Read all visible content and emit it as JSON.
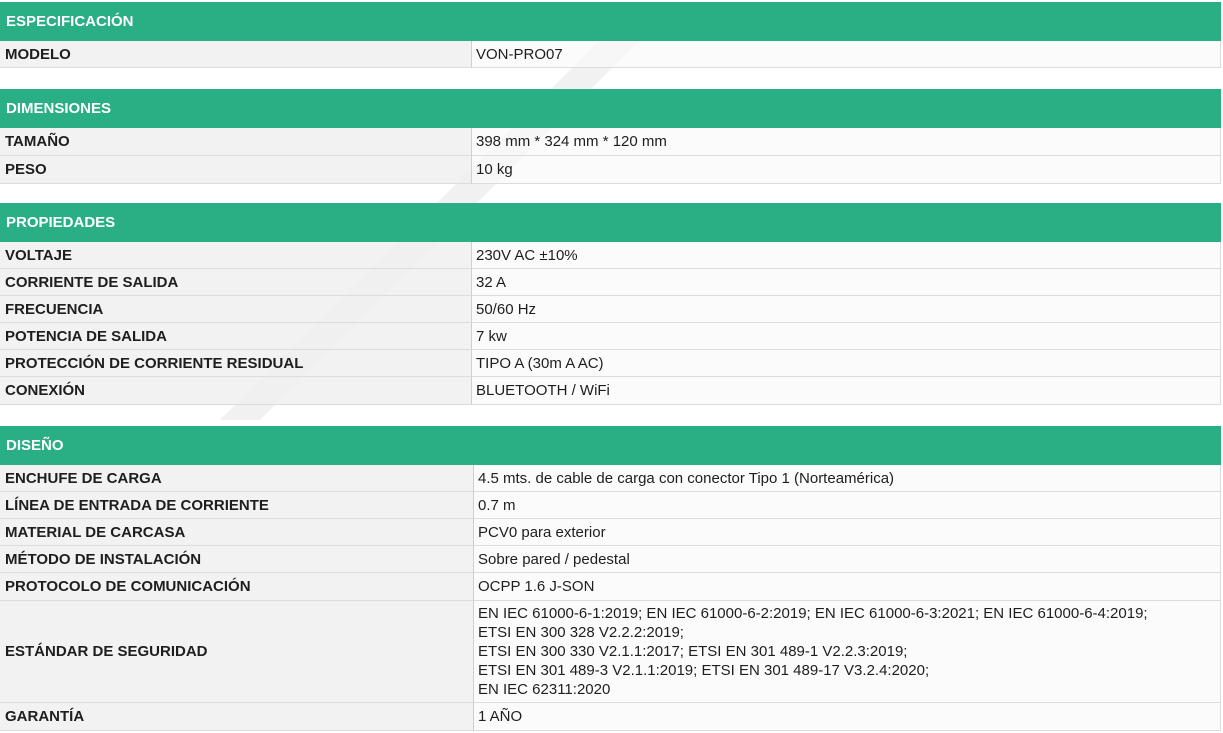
{
  "sections": [
    {
      "title": "ESPECIFICACIÓN",
      "rows": [
        {
          "label": "MODELO",
          "value": "VON-PRO07"
        }
      ]
    },
    {
      "title": "DIMENSIONES",
      "rows": [
        {
          "label": "TAMAÑO",
          "value": "398 mm * 324 mm * 120 mm"
        },
        {
          "label": "PESO",
          "value": "10 kg"
        }
      ]
    },
    {
      "title": "PROPIEDADES",
      "rows": [
        {
          "label": "VOLTAJE",
          "value": "230V AC ±10%"
        },
        {
          "label": "CORRIENTE DE SALIDA",
          "value": "32 A"
        },
        {
          "label": "FRECUENCIA",
          "value": "50/60 Hz"
        },
        {
          "label": "POTENCIA DE SALIDA",
          "value": "7 kw"
        },
        {
          "label": "PROTECCIÓN DE CORRIENTE RESIDUAL",
          "value": "TIPO A (30m A AC)"
        },
        {
          "label": "CONEXIÓN",
          "value": "BLUETOOTH / WiFi"
        }
      ]
    },
    {
      "title": "DISEÑO",
      "rows": [
        {
          "label": "ENCHUFE DE CARGA",
          "value": "4.5 mts. de cable de carga con conector Tipo 1 (Norteamérica)"
        },
        {
          "label": "LÍNEA DE ENTRADA DE CORRIENTE",
          "value": "0.7 m"
        },
        {
          "label": "MATERIAL DE CARCASA",
          "value": "PCV0 para exterior"
        },
        {
          "label": "MÉTODO DE INSTALACIÓN",
          "value": "Sobre pared / pedestal"
        },
        {
          "label": "PROTOCOLO DE COMUNICACIÓN",
          "value": "OCPP 1.6 J-SON"
        },
        {
          "label": "ESTÁNDAR DE SEGURIDAD",
          "lines": [
            "EN IEC 61000-6-1:2019; EN IEC 61000-6-2:2019; EN IEC 61000-6-3:2021; EN IEC 61000-6-4:2019;",
            "ETSI EN 300 328 V2.2.2:2019;",
            "ETSI EN 300 330 V2.1.1:2017; ETSI EN 301 489-1 V2.2.3:2019;",
            "ETSI EN 301 489-3 V2.1.1:2019; ETSI EN 301 489-17 V3.2.4:2020;",
            "EN IEC 62311:2020"
          ]
        },
        {
          "label": "GARANTÍA",
          "value": "1 AÑO"
        }
      ]
    }
  ]
}
